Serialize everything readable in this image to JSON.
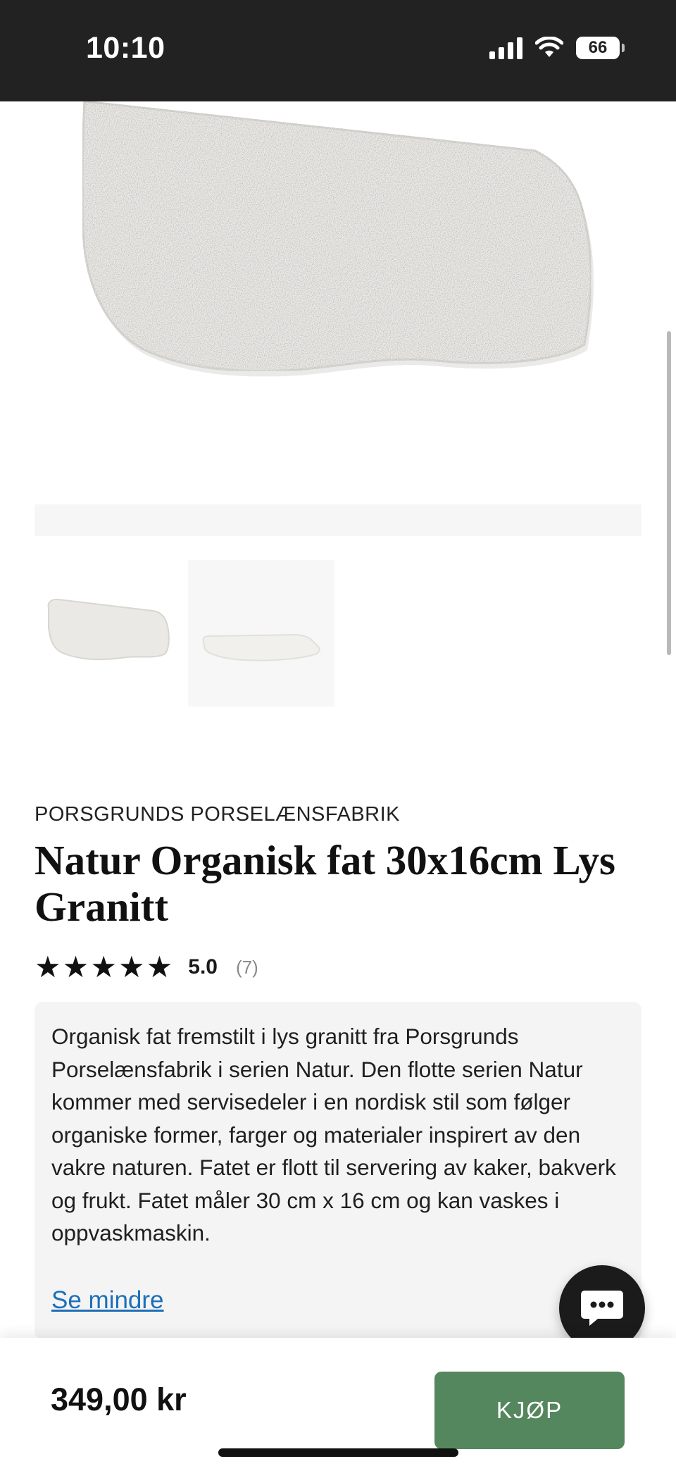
{
  "status_bar": {
    "time": "10:10",
    "battery": "66",
    "icons": [
      "signal-icon",
      "wifi-icon",
      "battery-icon"
    ]
  },
  "gallery": {
    "main_image": "organic-platter-top-view",
    "thumbnails": [
      "organic-platter-top-view",
      "organic-platter-side-view"
    ]
  },
  "product": {
    "brand": "PORSGRUNDS PORSELÆNSFABRIK",
    "title": "Natur Organisk fat 30x16cm Lys Granitt",
    "rating": {
      "score": "5.0",
      "count": "(7)",
      "stars_filled": 5,
      "stars_total": 5
    },
    "description": "Organisk fat fremstilt i lys granitt fra Porsgrunds Porselænsfabrik i serien Natur. Den flotte serien Natur kommer med servisedeler i en nordisk stil som følger organiske former, farger og materialer inspirert av den vakre naturen. Fatet er flott til servering av kaker, bakverk og frukt. Fatet måler 30 cm x 16 cm og kan vaskes i oppvaskmaskin.",
    "toggle_label": "Se mindre"
  },
  "chat": {
    "icon": "chat-bubble-icon"
  },
  "purchase": {
    "price": "349,00 kr",
    "buy_label": "KJØP"
  },
  "colors": {
    "status_bar": "#222222",
    "buy_button": "#55875e",
    "link": "#1e6fb8",
    "description_bg": "#f4f4f4"
  }
}
